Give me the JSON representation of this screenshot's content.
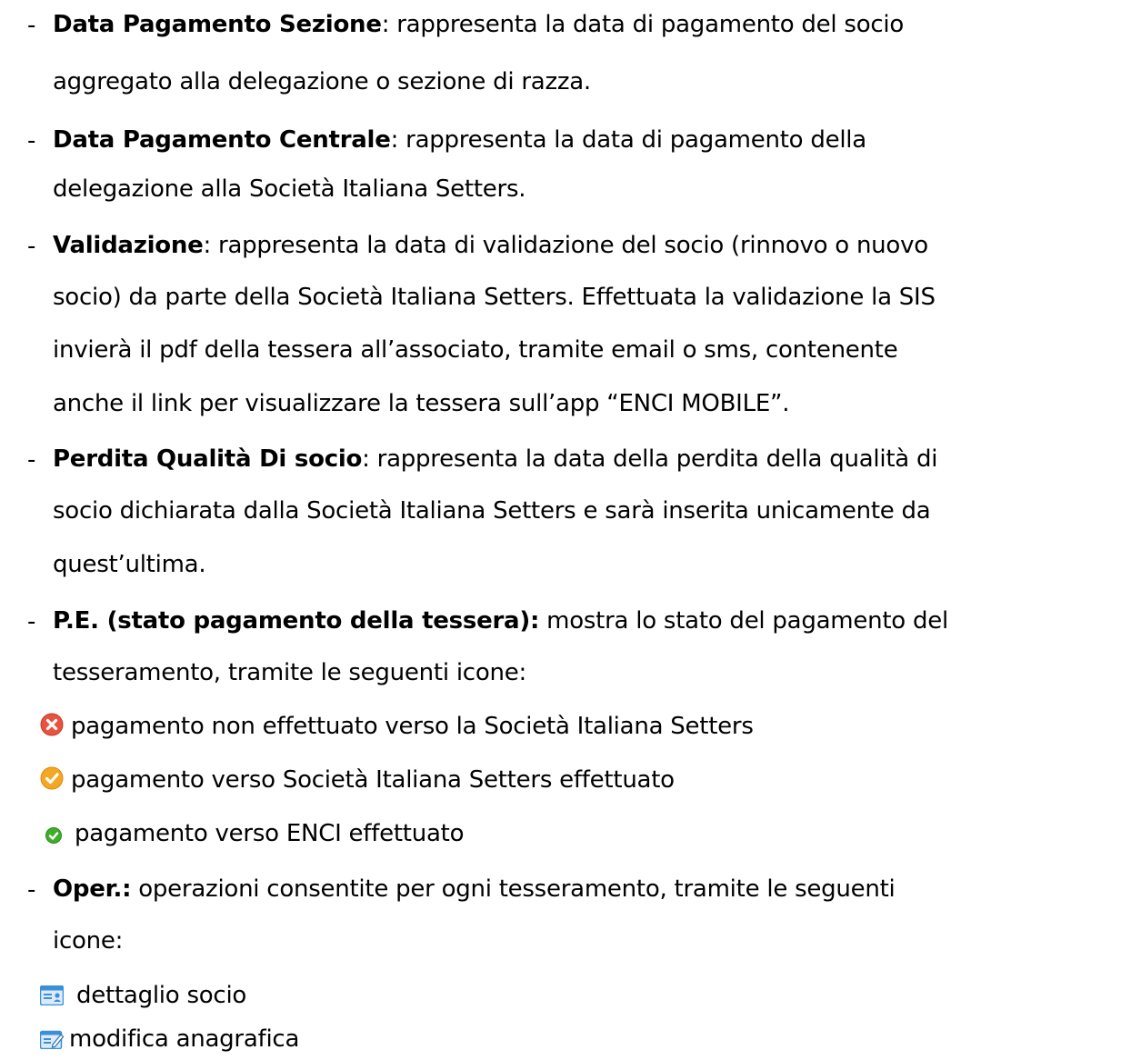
{
  "items": [
    {
      "term": "Data Pagamento Sezione",
      "rest_first": ": rappresenta la data di pagamento del socio",
      "lines": [
        "aggregato alla delegazione o sezione di razza."
      ]
    },
    {
      "term": "Data Pagamento Centrale",
      "rest_first": ": rappresenta la data di pagamento della",
      "lines": [
        "delegazione alla Società Italiana Setters."
      ]
    },
    {
      "term": "Validazione",
      "rest_first": ": rappresenta la data di validazione del socio (rinnovo o nuovo",
      "lines": [
        "socio) da parte della Società Italiana Setters. Effettuata la validazione la SIS",
        "invierà il pdf della tessera all’associato, tramite email o sms, contenente",
        "anche il link per visualizzare la tessera sull’app “ENCI MOBILE”."
      ]
    },
    {
      "term": "Perdita Qualità Di socio",
      "rest_first": ": rappresenta la data della perdita della qualità di",
      "lines": [
        "socio dichiarata dalla Società Italiana Setters e sarà inserita unicamente da",
        "quest’ultima."
      ]
    },
    {
      "term": "P.E. (stato pagamento della tessera):",
      "rest_first": " mostra lo stato del pagamento del",
      "lines": [
        "tesseramento, tramite le seguenti icone:"
      ],
      "icons": [
        {
          "icon": "red-x-circle-icon",
          "text": "pagamento non effettuato verso la Società Italiana Setters"
        },
        {
          "icon": "orange-check-circle-icon",
          "text": "pagamento verso Società Italiana Setters effettuato"
        },
        {
          "icon": "green-check-circle-icon",
          "text": "pagamento verso ENCI effettuato"
        }
      ]
    },
    {
      "term": "Oper.:",
      "rest_first": " operazioni consentite per ogni tesseramento, tramite le seguenti",
      "lines": [
        "icone:"
      ],
      "icons": [
        {
          "icon": "id-card-icon",
          "text": "dettaglio socio"
        },
        {
          "icon": "edit-card-icon",
          "text": "modifica anagrafica"
        }
      ]
    }
  ],
  "dash": "-",
  "colors": {
    "text": "#000000",
    "red_icon": "#e8533f",
    "orange_icon": "#f5a623",
    "green_icon": "#3fae2a",
    "blue_icon": "#3a8fd8"
  }
}
